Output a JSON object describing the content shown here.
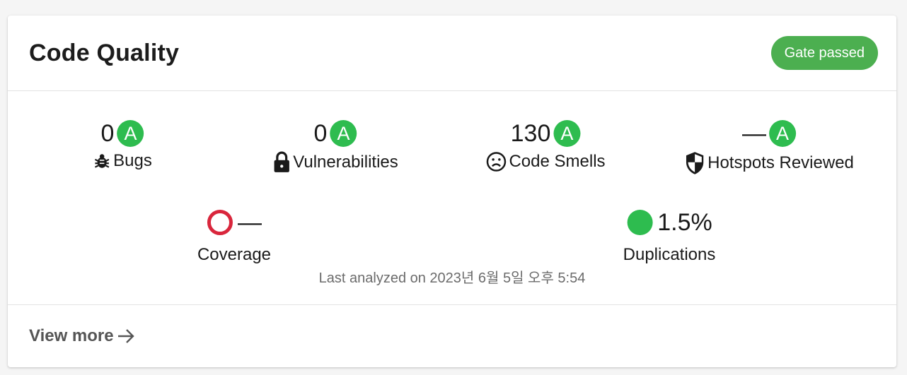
{
  "card": {
    "title": "Code Quality",
    "gate_status": "Gate passed",
    "colors": {
      "gate_passed": "#4caf50",
      "rating_a": "#2ebc4f",
      "coverage_ring": "#d9263c",
      "duplication_dot": "#2ebc4f"
    }
  },
  "metrics": [
    {
      "value": "0",
      "rating": "A",
      "label": "Bugs",
      "icon": "bug-icon"
    },
    {
      "value": "0",
      "rating": "A",
      "label": "Vulnerabilities",
      "icon": "lock-icon"
    },
    {
      "value": "130",
      "rating": "A",
      "label": "Code Smells",
      "icon": "sad-face-icon"
    },
    {
      "value": "—",
      "rating": "A",
      "label": "Hotspots Reviewed",
      "icon": "shield-icon"
    }
  ],
  "coverage": {
    "value": "—",
    "label": "Coverage",
    "icon": "coverage-ring-icon"
  },
  "duplications": {
    "value": "1.5%",
    "label": "Duplications",
    "icon": "duplication-dot-icon"
  },
  "last_analyzed": "Last analyzed on 2023년 6월 5일 오후 5:54",
  "footer": {
    "view_more_label": "View more",
    "icon": "arrow-right-icon"
  }
}
